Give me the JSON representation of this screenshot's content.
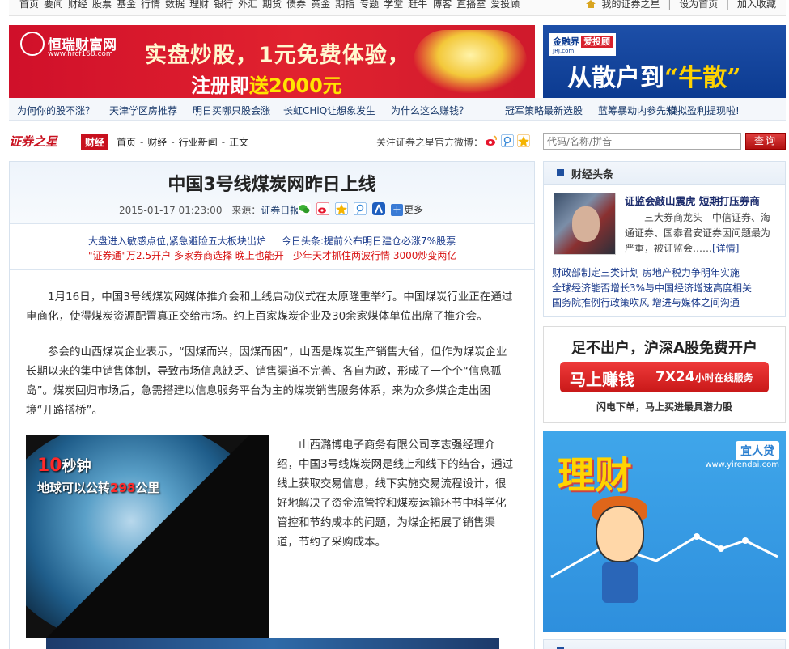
{
  "top_nav": {
    "links": [
      "首页",
      "要闻",
      "财经",
      "股票",
      "基金",
      "行情",
      "数据",
      "理财",
      "银行",
      "外汇",
      "期货",
      "债券",
      "黄金",
      "期指",
      "专题",
      "学堂",
      "赶牛",
      "博客",
      "直播室",
      "爱投顾"
    ],
    "my_account": "我的证券之星",
    "set_homepage": "设为首页",
    "add_favorite": "加入收藏"
  },
  "ad_left": {
    "brand_name": "恒瑞财富网",
    "brand_url": "www.hrcf168.com",
    "line1": "实盘炒股，1元免费体验，",
    "line2_prefix": "注册即",
    "line2_highlight": "送2000元"
  },
  "ad_right": {
    "brand": "金融界",
    "brand_tag": "爱投顾",
    "brand_sub": "JRJ.com",
    "slogan_prefix": "从散户到",
    "slogan_highlight": "“牛散”"
  },
  "promo_links": [
    "为何你的股不涨？",
    "天津学区房推荐",
    "明日买哪只股会涨",
    "长虹CHiQ让想象发生",
    "为什么这么赚钱？",
    "冠军策略最新选股",
    "蓝筹暴动内参先知",
    "模拟盈利提现啦!"
  ],
  "header": {
    "site_name": "证券之星",
    "section_tag": "财经",
    "breadcrumb": [
      "首页",
      "财经",
      "行业新闻",
      "正文"
    ],
    "follow_label": "关注证券之星官方微博：",
    "search_placeholder": "代码/名称/拼音",
    "search_button": "查询"
  },
  "article": {
    "title": "中国3号线煤炭网昨日上线",
    "datetime": "2015-01-17   01:23:00",
    "source_label": "来源：",
    "source": "证券日报",
    "share_more": "更多",
    "links": [
      {
        "text": "大盘进入敏感点位,紧急避险五大板块出炉",
        "color": "blue"
      },
      {
        "text": "今日头条:提前公布明日建仓必涨7%股票",
        "color": "blue"
      },
      {
        "text": "\"证券通\"万2.5开户 多家券商选择 晚上也能开",
        "color": "red"
      },
      {
        "text": "少年天才抓住两波行情 3000炒变两亿",
        "color": "red"
      }
    ],
    "paragraphs": [
      "1月16日，中国3号线煤炭网媒体推介会和上线启动仪式在太原隆重举行。中国煤炭行业正在通过电商化，使得煤炭资源配置真正交给市场。约上百家煤炭企业及30余家煤体单位出席了推介会。",
      "参会的山西煤炭企业表示，“因煤而兴，因煤而困”，山西是煤炭生产销售大省，但作为煤炭企业长期以来的集中销售体制，导致市场信息缺乏、销售渠道不完善、各自为政，形成了一个个“信息孤岛”。煤炭回归市场后，急需搭建以信息服务平台为主的煤炭销售服务体系，来为众多煤企走出困境“开路搭桥”。"
    ],
    "side_paragraph": "山西潞博电子商务有限公司李志强经理介绍，中国3号线煤炭网是线上和线下的结合，通过线上获取交易信息，线下实施交易流程设计，很好地解决了资金流管控和煤炭运输环节中科学化管控和节约成本的问题，为煤企拓展了销售渠道，节约了采购成本。",
    "image_ad": {
      "line1_num": "10",
      "line1_text": "秒钟",
      "line2_prefix": "地球可以公转",
      "line2_num": "298",
      "line2_suffix": "公里"
    }
  },
  "sidebar": {
    "finance_title": "财经头条",
    "headline": "证监会敲山震虎 短期打压券商",
    "summary": "三大券商龙头—中信证券、海通证券、国泰君安证券因问题最为严重，被证监会……",
    "detail_link": "[详情]",
    "links": [
      "财政部制定三类计划 房地产税力争明年实施",
      "全球经济能否增长3%与中国经济增速高度相关",
      "国务院推例行政策吹风 增进与媒体之间沟通"
    ],
    "ad_account": {
      "line1": "足不出户，沪深A股免费开户",
      "button_main": "马上赚钱",
      "button_sub_num": "7X24",
      "button_sub_text": "小时在线服务",
      "line3": "闪电下单，马上买进最具潜力股"
    },
    "ad_licai": {
      "brand": "宜人贷",
      "url": "www.yirendai.com",
      "big_text": "理财"
    }
  },
  "colors": {
    "brand_red": "#c8101e",
    "link_blue": "#1a3a8b",
    "ad_blue": "#0c3b91"
  }
}
